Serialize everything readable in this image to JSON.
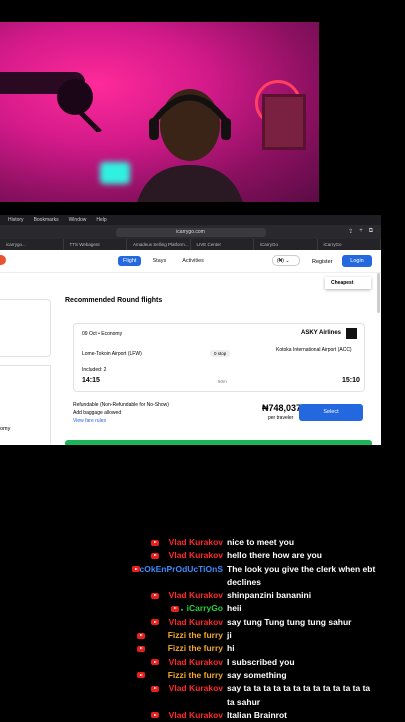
{
  "browser": {
    "menu": [
      "History",
      "Bookmarks",
      "Window",
      "Help"
    ],
    "url": "icarrygo.com",
    "tabs": [
      "icarrygo...",
      "TTS Webagent",
      "Amadeus Selling Platform...",
      "LIVE Center",
      "iCarryGo",
      "iCarryGo"
    ],
    "nav": {
      "flight": "Flight",
      "stays": "Stays",
      "activities": "Activities",
      "currency": "(₦)",
      "register": "Register",
      "login": "Login"
    },
    "sort": "Cheapest",
    "side_text": "omy",
    "section_title": "Recommended Round flights",
    "flight": {
      "date": "09 Oct • Economy",
      "airline": "ASKY Airlines",
      "from": "Lome-Tokoin Airport (LFW)",
      "stops": "0 stop",
      "to": "Kotoka International Airport (ACC)",
      "included": "Included: 2",
      "depart": "14:15",
      "duration": "50m",
      "arrive": "15:10"
    },
    "refund": "Refundable (Non-Refundable for No-Show)",
    "baggage": "Add baggage allowed",
    "fare_rules": "View fare rules",
    "price": "₦748,037",
    "per_traveler": "per traveler",
    "select": "Select"
  },
  "chat": [
    {
      "name": "Vlad Kurakov",
      "color": "#ff2a2a",
      "text": "nice to meet you"
    },
    {
      "name": "Vlad Kurakov",
      "color": "#ff2a2a",
      "text": "hello there how are you"
    },
    {
      "name": "cOkEnPrOdUcTiOnS",
      "color": "#3c8cff",
      "text": "The look you give the clerk when ebt"
    },
    {
      "name": "",
      "color": "#fff",
      "text": "declines"
    },
    {
      "name": "Vlad Kurakov",
      "color": "#ff2a2a",
      "text": "shinpanzini bananini"
    },
    {
      "name": "iCarryGo",
      "color": "#2ad13a",
      "text": "heii"
    },
    {
      "name": "Vlad Kurakov",
      "color": "#ff2a2a",
      "text": "say tung Tung tung tung sahur"
    },
    {
      "name": "Fizzi the furry",
      "color": "#f2a82c",
      "text": "ji"
    },
    {
      "name": "Fizzi the furry",
      "color": "#f2a82c",
      "text": "hi"
    },
    {
      "name": "Vlad Kurakov",
      "color": "#ff2a2a",
      "text": "I subscribed you"
    },
    {
      "name": "Fizzi the furry",
      "color": "#f2a82c",
      "text": "say something"
    },
    {
      "name": "Vlad Kurakov",
      "color": "#ff2a2a",
      "text": "say ta ta ta ta ta ta ta ta ta ta ta ta ta"
    },
    {
      "name": "",
      "color": "#fff",
      "text": "ta sahur"
    },
    {
      "name": "Vlad Kurakov",
      "color": "#ff2a2a",
      "text": "Italian Brainrot"
    }
  ]
}
